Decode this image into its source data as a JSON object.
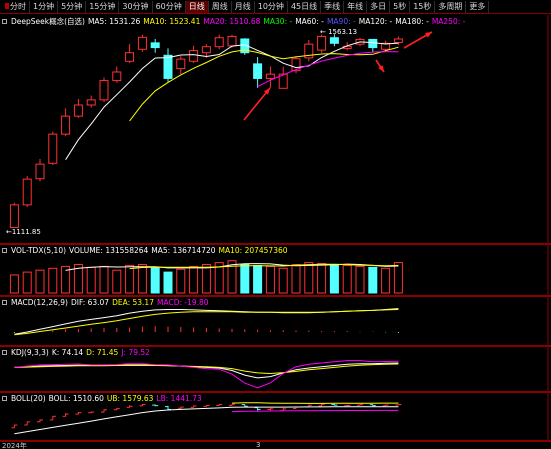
{
  "toolbar": {
    "buttons": [
      "分时",
      "1分钟",
      "5分钟",
      "15分钟",
      "30分钟",
      "60分钟",
      "日线",
      "周线",
      "月线",
      "10分钟",
      "45日线",
      "季线",
      "年线",
      "多日",
      "5秒",
      "15秒",
      "多周期",
      "更多"
    ],
    "active_index": 6
  },
  "main": {
    "title": "DeepSeek概念(自选)",
    "ma": [
      {
        "label": "MA5: 1531.26",
        "color": "#ffffff"
      },
      {
        "label": "MA10: 1523.41",
        "color": "#ffff00"
      },
      {
        "label": "MA20: 1510.68",
        "color": "#ff00ff"
      },
      {
        "label": "MA30: -",
        "color": "#00ff00"
      },
      {
        "label": "MA60: -",
        "color": "#ffffff"
      },
      {
        "label": "MA90: -",
        "color": "#5555ff"
      },
      {
        "label": "MA120: -",
        "color": "#ffffff"
      },
      {
        "label": "MA180: -",
        "color": "#ffffff"
      },
      {
        "label": "MA250: -",
        "color": "#ff00ff"
      }
    ],
    "high_label": "1563.13",
    "low_label": "1111.85"
  },
  "volume_panel": {
    "title": "VOL-TDX(5,10)",
    "items": [
      {
        "label": "VOLUME: 131558264",
        "color": "#ffffff"
      },
      {
        "label": "MA5: 136714720",
        "color": "#ffffff"
      },
      {
        "label": "MA10: 207457360",
        "color": "#ffff00"
      }
    ]
  },
  "macd_panel": {
    "title": "MACD(12,26,9)",
    "items": [
      {
        "label": "DIF: 63.07",
        "color": "#ffffff"
      },
      {
        "label": "DEA: 53.17",
        "color": "#ffff00"
      },
      {
        "label": "MACD: -19.80",
        "color": "#ff00ff"
      }
    ]
  },
  "kdj_panel": {
    "title": "KDJ(9,3,3)",
    "items": [
      {
        "label": "K: 74.14",
        "color": "#ffffff"
      },
      {
        "label": "D: 71.45",
        "color": "#ffff00"
      },
      {
        "label": "J: 79.52",
        "color": "#ff00ff"
      }
    ]
  },
  "boll_panel": {
    "title": "BOLL(20)",
    "items": [
      {
        "label": "BOLL: 1510.60",
        "color": "#ffffff"
      },
      {
        "label": "UB: 1579.63",
        "color": "#ffff00"
      },
      {
        "label": "LB: 1441.73",
        "color": "#ff00ff"
      }
    ]
  },
  "date_label": "2024年",
  "month_label": "3",
  "colors": {
    "up": "#ff3232",
    "down": "#54ffff",
    "grid": "#8a0000",
    "ma5": "#ffffff",
    "ma10": "#ffff00",
    "ma20": "#ff00ff"
  },
  "chart_data": {
    "type": "candlestick",
    "title": "DeepSeek概念(自选)",
    "candles": [
      {
        "o": 1112,
        "c": 1165,
        "h": 1170,
        "l": 1112
      },
      {
        "o": 1165,
        "c": 1225,
        "h": 1232,
        "l": 1160
      },
      {
        "o": 1226,
        "c": 1260,
        "h": 1272,
        "l": 1220
      },
      {
        "o": 1262,
        "c": 1330,
        "h": 1336,
        "l": 1258
      },
      {
        "o": 1330,
        "c": 1372,
        "h": 1390,
        "l": 1325
      },
      {
        "o": 1372,
        "c": 1398,
        "h": 1412,
        "l": 1368
      },
      {
        "o": 1398,
        "c": 1410,
        "h": 1420,
        "l": 1392
      },
      {
        "o": 1410,
        "c": 1455,
        "h": 1462,
        "l": 1405
      },
      {
        "o": 1455,
        "c": 1475,
        "h": 1488,
        "l": 1450
      },
      {
        "o": 1500,
        "c": 1520,
        "h": 1540,
        "l": 1496
      },
      {
        "o": 1528,
        "c": 1556,
        "h": 1562,
        "l": 1522
      },
      {
        "o": 1543,
        "c": 1532,
        "h": 1552,
        "l": 1520
      },
      {
        "o": 1514,
        "c": 1460,
        "h": 1530,
        "l": 1452
      },
      {
        "o": 1483,
        "c": 1505,
        "h": 1512,
        "l": 1470
      },
      {
        "o": 1500,
        "c": 1525,
        "h": 1536,
        "l": 1496
      },
      {
        "o": 1520,
        "c": 1534,
        "h": 1540,
        "l": 1508
      },
      {
        "o": 1534,
        "c": 1555,
        "h": 1562,
        "l": 1528
      },
      {
        "o": 1536,
        "c": 1558,
        "h": 1562,
        "l": 1532
      },
      {
        "o": 1552,
        "c": 1520,
        "h": 1554,
        "l": 1515
      },
      {
        "o": 1494,
        "c": 1460,
        "h": 1510,
        "l": 1438
      },
      {
        "o": 1460,
        "c": 1470,
        "h": 1488,
        "l": 1438
      },
      {
        "o": 1437,
        "c": 1470,
        "h": 1487,
        "l": 1437
      },
      {
        "o": 1478,
        "c": 1506,
        "h": 1512,
        "l": 1472
      },
      {
        "o": 1508,
        "c": 1540,
        "h": 1550,
        "l": 1500
      },
      {
        "o": 1526,
        "c": 1558,
        "h": 1562,
        "l": 1520
      },
      {
        "o": 1555,
        "c": 1542,
        "h": 1563,
        "l": 1535
      },
      {
        "o": 1530,
        "c": 1535,
        "h": 1545,
        "l": 1525
      },
      {
        "o": 1540,
        "c": 1551,
        "h": 1555,
        "l": 1535
      },
      {
        "o": 1551,
        "c": 1532,
        "h": 1552,
        "l": 1522
      },
      {
        "o": 1528,
        "c": 1542,
        "h": 1548,
        "l": 1522
      },
      {
        "o": 1544,
        "c": 1552,
        "h": 1558,
        "l": 1538
      }
    ],
    "ylim": [
      1090,
      1580
    ],
    "volume": [
      95,
      110,
      120,
      130,
      140,
      150,
      135,
      140,
      120,
      145,
      150,
      135,
      110,
      125,
      140,
      150,
      160,
      170,
      150,
      145,
      140,
      130,
      150,
      160,
      155,
      150,
      145,
      140,
      135,
      130,
      160
    ],
    "volume_ylim": [
      0,
      200
    ],
    "macd_hist": [
      -2,
      1,
      2,
      4,
      6,
      7,
      8,
      9,
      9,
      10,
      12,
      13,
      12,
      11,
      10,
      9,
      8,
      7,
      6,
      5,
      4,
      4,
      3,
      3,
      2,
      2,
      2,
      1,
      1,
      -1,
      -2
    ],
    "dif": [
      -5,
      0,
      6,
      12,
      18,
      24,
      28,
      32,
      36,
      42,
      46,
      49,
      50,
      50,
      49,
      48,
      47,
      46,
      45,
      44,
      44,
      43,
      43,
      43,
      44,
      45,
      46,
      47,
      48,
      50,
      52
    ],
    "dea": [
      -6,
      -3,
      1,
      5,
      9,
      13,
      17,
      21,
      25,
      30,
      35,
      39,
      42,
      44,
      45,
      45,
      45,
      45,
      44,
      44,
      44,
      44,
      44,
      44,
      44,
      45,
      46,
      47,
      48,
      49,
      50
    ],
    "macd_ylim": [
      -20,
      60
    ],
    "k": [
      60,
      62,
      64,
      65,
      66,
      67,
      66,
      66,
      67,
      68,
      68,
      67,
      66,
      64,
      62,
      60,
      58,
      50,
      35,
      26,
      30,
      42,
      52,
      58,
      62,
      66,
      70,
      72,
      72,
      73,
      74
    ],
    "d": [
      60,
      61,
      62,
      63,
      64,
      65,
      65,
      65,
      66,
      66,
      66,
      66,
      65,
      64,
      63,
      62,
      60,
      56,
      48,
      42,
      40,
      43,
      47,
      52,
      56,
      60,
      64,
      67,
      69,
      70,
      71
    ],
    "j": [
      60,
      64,
      68,
      69,
      70,
      71,
      68,
      68,
      69,
      72,
      72,
      69,
      68,
      64,
      60,
      56,
      54,
      38,
      9,
      -6,
      10,
      40,
      62,
      70,
      74,
      78,
      82,
      82,
      78,
      79,
      80
    ],
    "kdj_ylim": [
      -10,
      100
    ],
    "boll_mid": [
      1000,
      1040,
      1080,
      1120,
      1160,
      1200,
      1240,
      1280,
      1320,
      1360,
      1400,
      1430,
      1450,
      1460,
      1470,
      1480,
      1490,
      1500,
      1505,
      1505,
      1505,
      1505,
      1507,
      1508,
      1509,
      1510,
      1510,
      1510,
      1510,
      1511,
      1511
    ],
    "boll_ub": [
      null,
      null,
      null,
      null,
      null,
      null,
      null,
      null,
      null,
      null,
      null,
      null,
      null,
      null,
      null,
      null,
      null,
      1580,
      1585,
      1585,
      1580,
      1578,
      1576,
      1575,
      1575,
      1576,
      1577,
      1578,
      1579,
      1580,
      1580
    ],
    "boll_lb": [
      null,
      null,
      null,
      null,
      null,
      null,
      null,
      null,
      null,
      null,
      null,
      null,
      null,
      null,
      null,
      null,
      null,
      1420,
      1425,
      1425,
      1430,
      1432,
      1434,
      1436,
      1438,
      1439,
      1440,
      1440,
      1441,
      1442,
      1442
    ],
    "boll_ylim": [
      900,
      1620
    ]
  }
}
